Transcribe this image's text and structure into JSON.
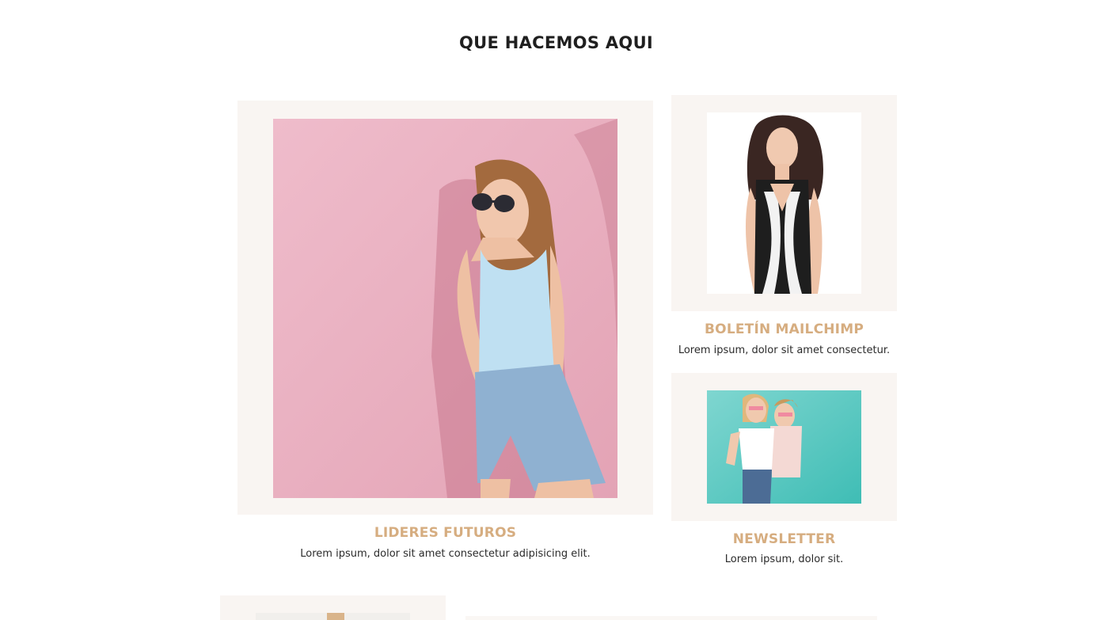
{
  "section": {
    "title": "QUE HACEMOS AQUI"
  },
  "cards": [
    {
      "title": "LIDERES FUTUROS",
      "text": "Lorem ipsum, dolor sit amet consectetur adipisicing elit.",
      "image": "woman-pink-background-photo"
    },
    {
      "title": "BOLETÍN MAILCHIMP",
      "text": "Lorem ipsum, dolor sit amet consectetur.",
      "image": "woman-black-white-dress-photo"
    },
    {
      "title": "NEWSLETTER",
      "text": "Lorem ipsum, dolor sit.",
      "image": "two-women-teal-background-photo"
    }
  ],
  "colors": {
    "background": "#ffffff",
    "card_background": "#f9f5f2",
    "title_text": "#1f1f1f",
    "accent_gold": "#d6ad80",
    "body_text": "#2b2b2b"
  }
}
